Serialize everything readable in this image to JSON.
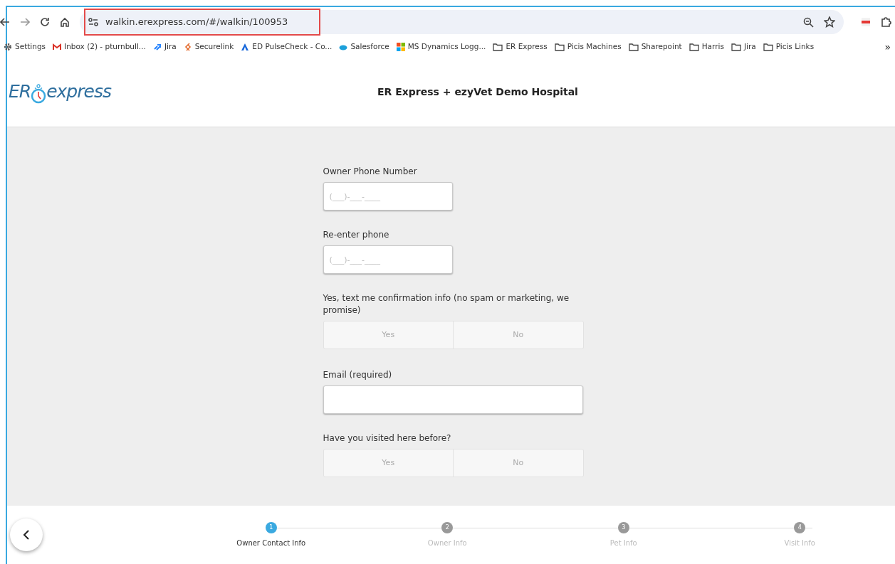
{
  "browser": {
    "url": "walkin.erexpress.com/#/walkin/100953",
    "url_highlighted": true,
    "bookmarks": [
      {
        "kind": "gear",
        "label": "Settings"
      },
      {
        "kind": "mail",
        "label": "Inbox (2) - pturnbull..."
      },
      {
        "kind": "jira",
        "label": "Jira"
      },
      {
        "kind": "swirl",
        "label": "Securelink"
      },
      {
        "kind": "atlas",
        "label": "ED PulseCheck - Co..."
      },
      {
        "kind": "cloud",
        "label": "Salesforce"
      },
      {
        "kind": "tiles",
        "label": "MS Dynamics Logg..."
      },
      {
        "kind": "folder",
        "label": "ER Express"
      },
      {
        "kind": "folder",
        "label": "Picis Machines"
      },
      {
        "kind": "folder",
        "label": "Sharepoint"
      },
      {
        "kind": "folder",
        "label": "Harris"
      },
      {
        "kind": "folder",
        "label": "Jira"
      },
      {
        "kind": "folder",
        "label": "Picis Links"
      }
    ],
    "more": "»"
  },
  "header": {
    "logo": {
      "left": "ER",
      "right": "express"
    },
    "title": "ER Express + ezyVet Demo Hospital"
  },
  "form": [
    {
      "kind": "input",
      "label": "Owner Phone Number",
      "placeholder": "(___)-___-____",
      "wide": false
    },
    {
      "kind": "input",
      "label": "Re-enter phone",
      "placeholder": "(___)-___-____",
      "wide": false
    },
    {
      "kind": "choice",
      "label": "Yes, text me confirmation info (no spam or marketing, we promise)",
      "options": [
        {
          "label": "Yes",
          "selected": false
        },
        {
          "label": "No",
          "selected": false
        }
      ]
    },
    {
      "kind": "input",
      "label": "Email (required)",
      "wide": true
    },
    {
      "kind": "choice",
      "label": "Have you visited here before?",
      "options": [
        {
          "label": "Yes",
          "selected": false
        },
        {
          "label": "No",
          "selected": false
        }
      ]
    }
  ],
  "steps": [
    {
      "number": "1",
      "label": "Owner Contact Info",
      "selected": true
    },
    {
      "number": "2",
      "label": "Owner Info",
      "selected": false
    },
    {
      "number": "3",
      "label": "Pet Info",
      "selected": false
    },
    {
      "number": "4",
      "label": "Visit Info",
      "selected": false
    }
  ]
}
